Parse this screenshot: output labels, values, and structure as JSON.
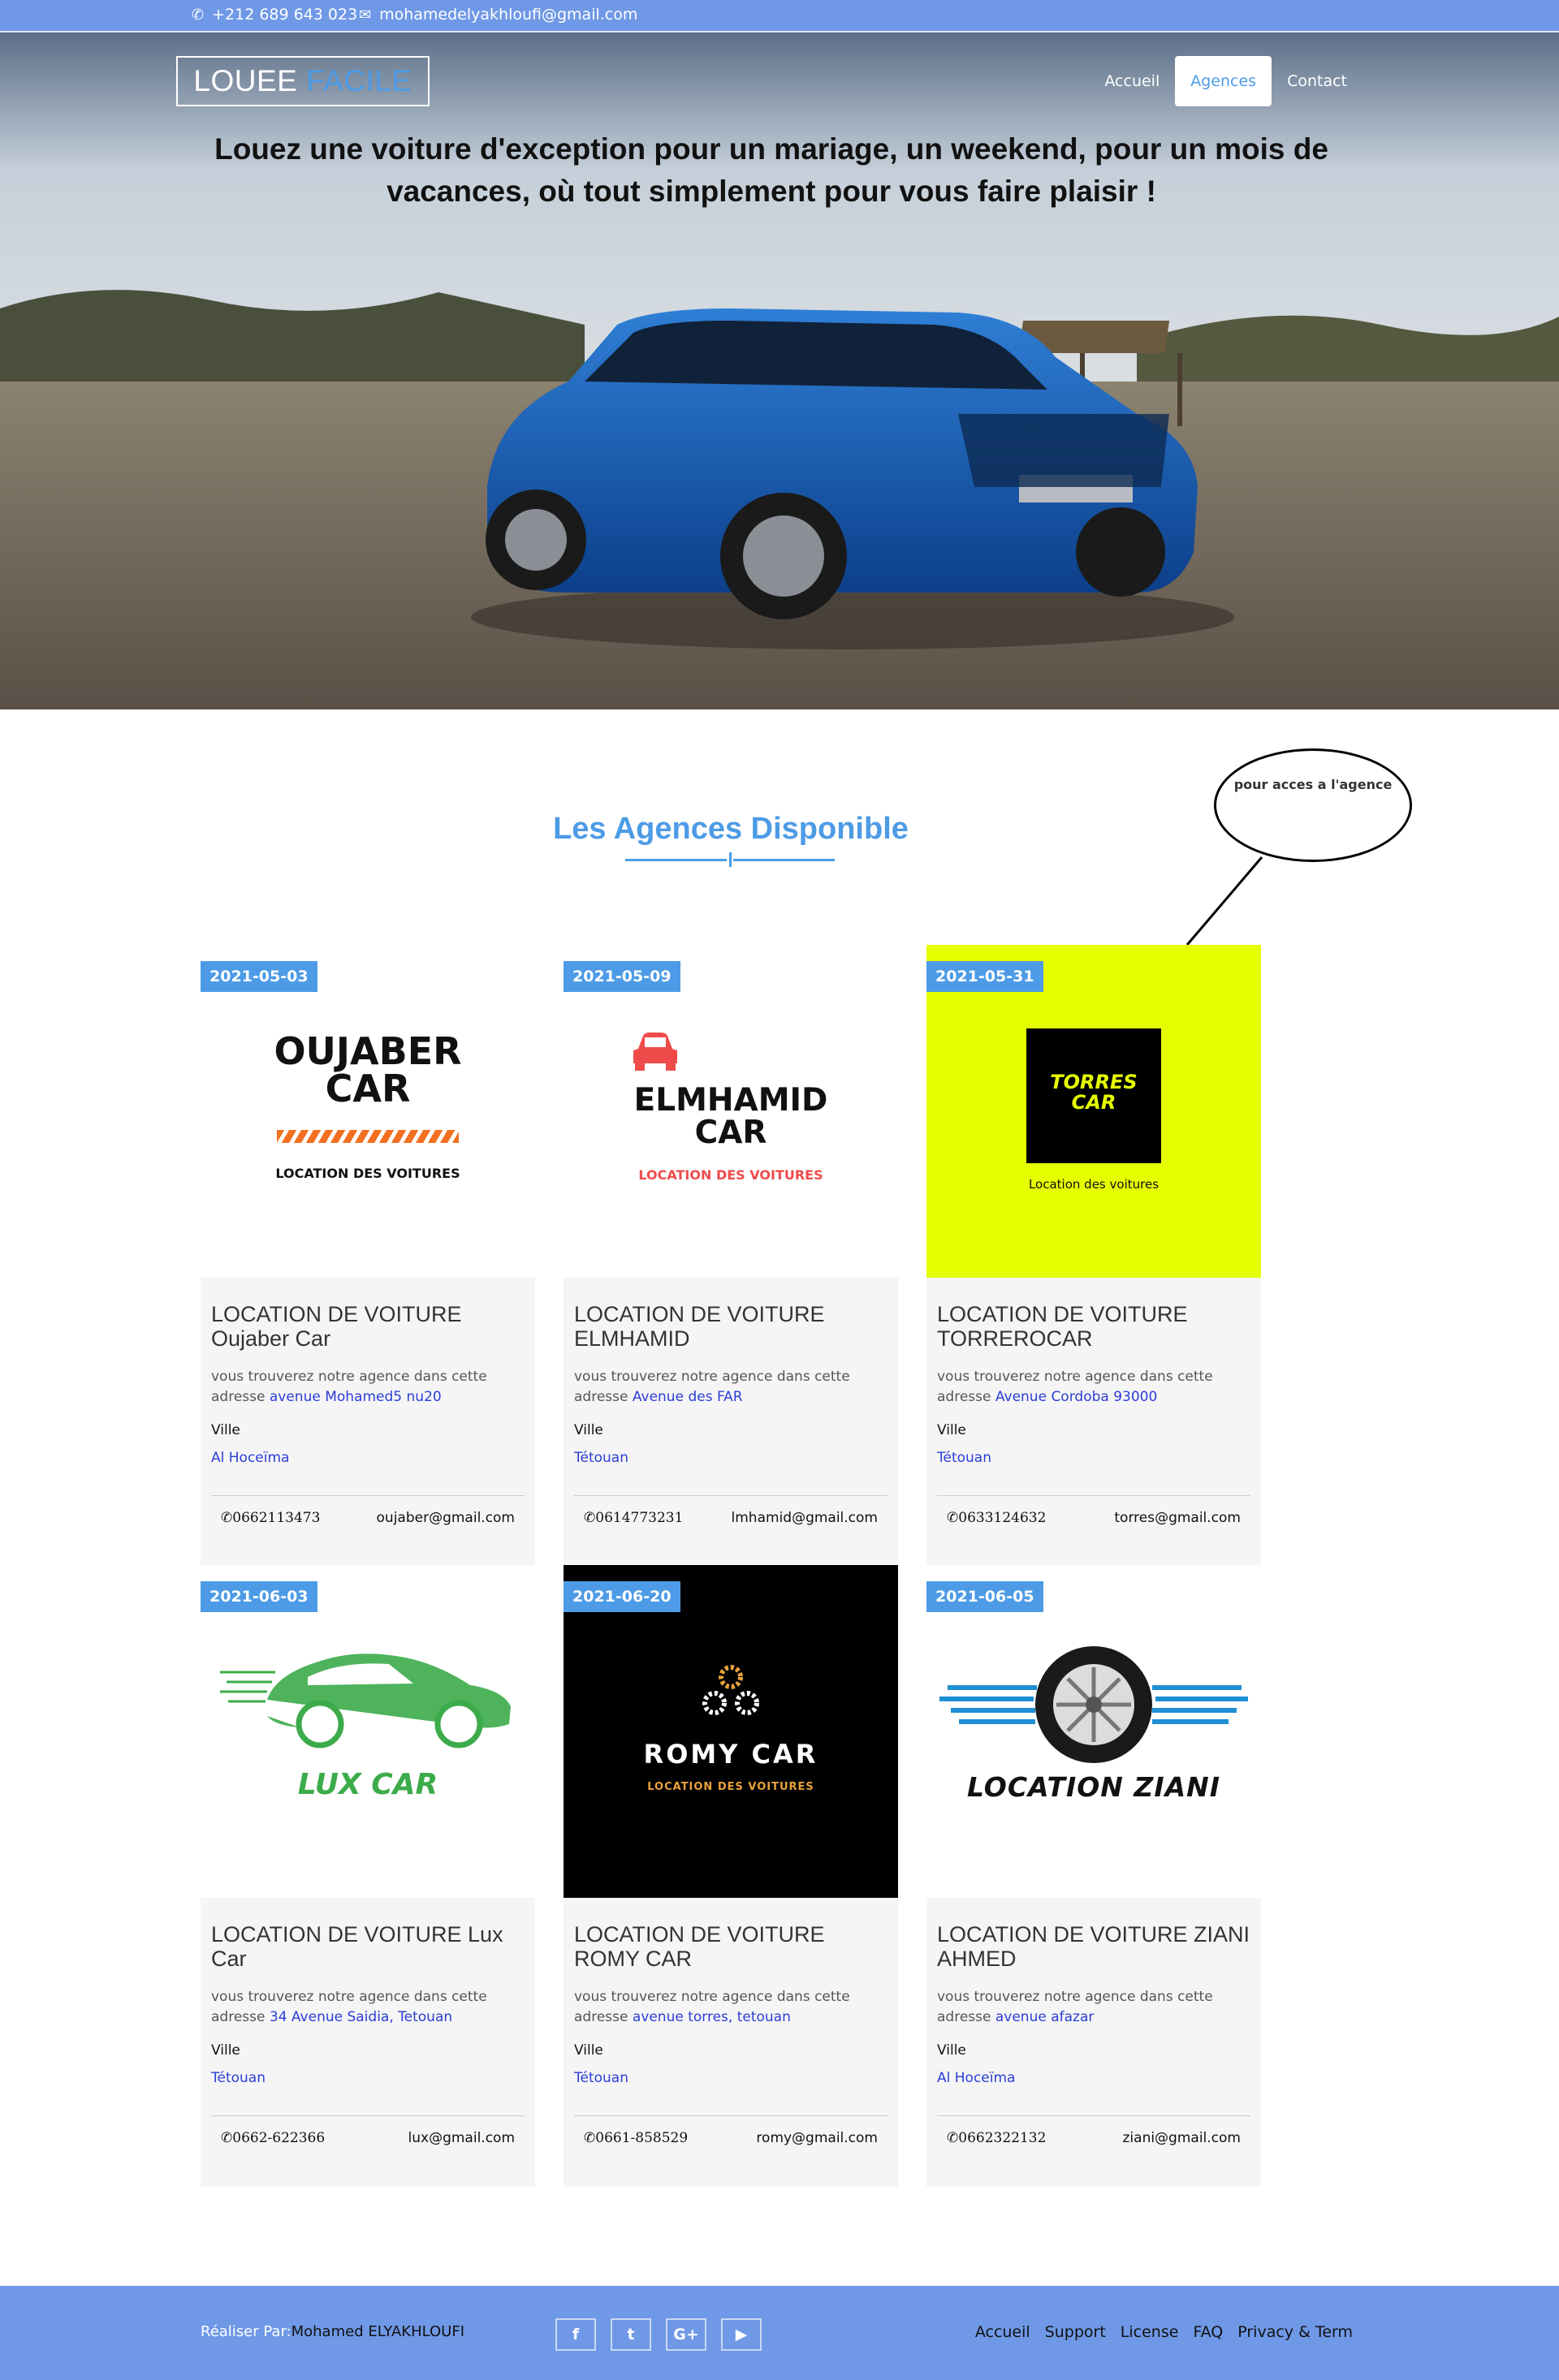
{
  "topbar": {
    "phone": "+212 689 643 023",
    "email": "mohamedelyakhloufi@gmail.com",
    "phone_icon": "phone-icon",
    "email_icon": "envelope-icon"
  },
  "brand": {
    "part1": "LOUEE",
    "part2": "FACILE"
  },
  "nav": {
    "items": [
      "Accueil",
      "Agences",
      "Contact"
    ],
    "active": "Agences"
  },
  "hero": {
    "headline": "Louez une voiture d'exception pour un mariage, un weekend, pour un mois de vacances, où tout simplement pour vous faire plaisir !"
  },
  "section": {
    "title": "Les Agences Disponible"
  },
  "callout": {
    "text": "pour acces a l'agence"
  },
  "common": {
    "desc_prefix": "vous trouverez notre agence dans cette adresse",
    "ville_label": "Ville"
  },
  "agencies": [
    {
      "date": "2021-05-03",
      "title": "LOCATION DE VOITURE Oujaber Car",
      "address": "avenue Mohamed5 nu20",
      "city": "Al Hoceïma",
      "phone": "0662113473",
      "email": "oujaber@gmail.com",
      "logo": {
        "line1": "OUJABER",
        "line2": "CAR",
        "tagline": "LOCATION DES VOITURES"
      }
    },
    {
      "date": "2021-05-09",
      "title": "LOCATION DE VOITURE ELMHAMID",
      "address": "Avenue des FAR",
      "city": "Tétouan",
      "phone": "0614773231",
      "email": "lmhamid@gmail.com",
      "logo": {
        "line1": "ELMHAMID",
        "line2": "CAR",
        "tagline": "LOCATION DES VOITURES"
      }
    },
    {
      "date": "2021-05-31",
      "title": "LOCATION DE VOITURE TORREROCAR",
      "address": "Avenue Cordoba 93000",
      "city": "Tétouan",
      "phone": "0633124632",
      "email": "torres@gmail.com",
      "logo": {
        "line1": "TORRES",
        "line2": "CAR",
        "tagline": "Location des voitures"
      }
    },
    {
      "date": "2021-06-03",
      "title": "LOCATION DE VOITURE Lux Car",
      "address": "34 Avenue Saidia, Tetouan",
      "city": "Tétouan",
      "phone": "0662-622366",
      "email": "lux@gmail.com",
      "logo": {
        "line1": "LUX CAR"
      }
    },
    {
      "date": "2021-06-20",
      "title": "LOCATION DE VOITURE ROMY CAR",
      "address": "avenue torres, tetouan",
      "city": "Tétouan",
      "phone": "0661-858529",
      "email": "romy@gmail.com",
      "logo": {
        "line1": "ROMY CAR",
        "tagline": "LOCATION DES VOITURES"
      }
    },
    {
      "date": "2021-06-05",
      "title": "LOCATION DE VOITURE ZIANI AHMED",
      "address": "avenue afazar",
      "city": "Al Hoceïma",
      "phone": "0662322132",
      "email": "ziani@gmail.com",
      "logo": {
        "line1": "LOCATION ZIANI"
      }
    }
  ],
  "footer": {
    "credit_prefix": "Réaliser Par:",
    "credit_name": "Mohamed ELYAKHLOUFI",
    "socials": [
      "facebook-icon",
      "twitter-icon",
      "google-plus-icon",
      "youtube-icon"
    ],
    "social_glyphs": [
      "f",
      "t",
      "G+",
      "▶"
    ],
    "links": [
      "Accueil",
      "Support",
      "License",
      "FAQ",
      "Privacy & Term"
    ]
  },
  "colors": {
    "accent": "#4d9be6",
    "bar": "#6f98e6",
    "link": "#2b3ed6",
    "torres_bg": "#e5fe00"
  }
}
